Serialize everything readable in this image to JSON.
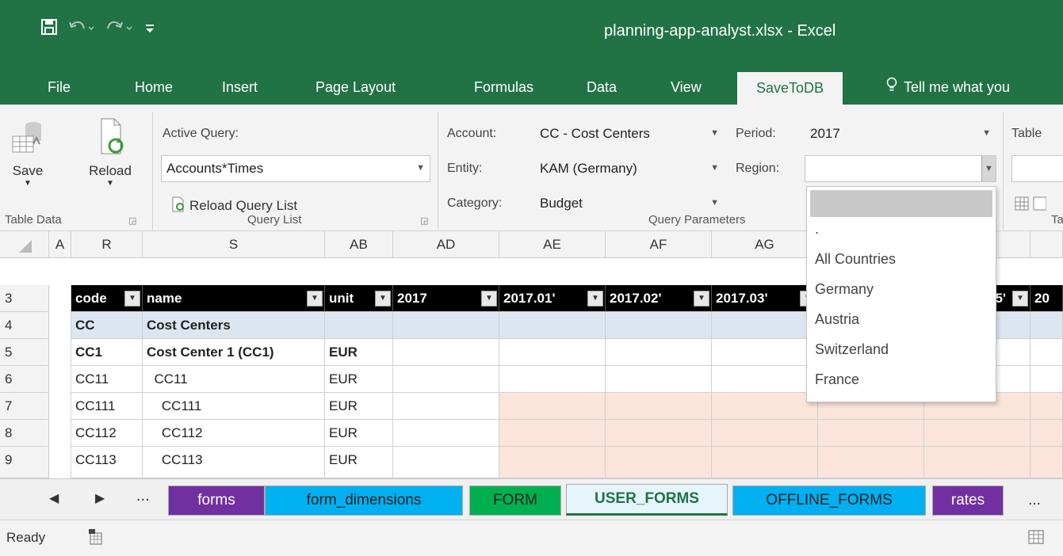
{
  "window": {
    "title": "planning-app-analyst.xlsx  -  Excel"
  },
  "tabs": [
    "File",
    "Home",
    "Insert",
    "Page Layout",
    "Formulas",
    "Data",
    "View",
    "SaveToDB",
    "Tell me what you"
  ],
  "ribbon": {
    "save_label": "Save",
    "reload_label": "Reload",
    "active_query_label": "Active Query:",
    "active_query_value": "Accounts*Times",
    "reload_query_list": "Reload Query List",
    "account_label": "Account:",
    "account_value": "CC - Cost Centers",
    "entity_label": "Entity:",
    "entity_value": "KAM (Germany)",
    "category_label": "Category:",
    "category_value": "Budget",
    "period_label": "Period:",
    "period_value": "2017",
    "region_label": "Region:",
    "region_value": "",
    "table_label": "Table",
    "groups": [
      "Table Data",
      "Query List",
      "Query Parameters",
      "Ta"
    ]
  },
  "region_dropdown": {
    "options": [
      "",
      ".",
      "All Countries",
      "Germany",
      "Austria",
      "Switzerland",
      "France"
    ]
  },
  "grid": {
    "columns": [
      "A",
      "R",
      "S",
      "AB",
      "AD",
      "AE",
      "AF",
      "AG"
    ],
    "header_row": {
      "row": "3",
      "cells": [
        "code",
        "name",
        "unit",
        "2017",
        "2017.01'",
        "2017.02'",
        "2017.03'",
        "",
        "5'",
        "20"
      ]
    },
    "rows": [
      {
        "num": "4",
        "code": "CC",
        "name": "Cost Centers",
        "unit": ""
      },
      {
        "num": "5",
        "code": "CC1",
        "name": "Cost Center 1 (CC1)",
        "unit": "EUR"
      },
      {
        "num": "6",
        "code": "CC11",
        "name": "  CC11",
        "unit": "EUR"
      },
      {
        "num": "7",
        "code": "CC111",
        "name": "    CC111",
        "unit": "EUR"
      },
      {
        "num": "8",
        "code": "CC112",
        "name": "    CC112",
        "unit": "EUR"
      },
      {
        "num": "9",
        "code": "CC113",
        "name": "    CC113",
        "unit": "EUR"
      }
    ]
  },
  "sheet_tabs": [
    "forms",
    "form_dimensions",
    "FORM",
    "USER_FORMS",
    "OFFLINE_FORMS",
    "rates",
    "..."
  ],
  "sheet_nav_more": "...",
  "status": {
    "ready": "Ready"
  },
  "colors": {
    "excel_green": "#217346",
    "tab_purple": "#7030a0",
    "tab_blue": "#00b0f0",
    "tab_green": "#00b050"
  }
}
